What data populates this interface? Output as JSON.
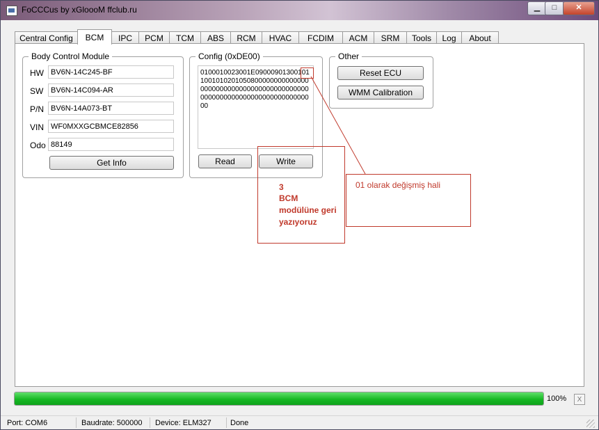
{
  "window": {
    "title": "FoCCCus by xGloooM ffclub.ru",
    "min": "▁",
    "max": "□",
    "close": "✕"
  },
  "tabs": [
    "Central Config",
    "BCM",
    "IPC",
    "PCM",
    "TCM",
    "ABS",
    "RCM",
    "HVAC",
    "FCDIM",
    "ACM",
    "SRM",
    "Tools",
    "Log",
    "About"
  ],
  "active_tab": "BCM",
  "bcm": {
    "title": "Body Control Module",
    "hw_label": "HW",
    "hw_value": "BV6N-14C245-BF",
    "sw_label": "SW",
    "sw_value": "BV6N-14C094-AR",
    "pn_label": "P/N",
    "pn_value": "BV6N-14A073-BT",
    "vin_label": "VIN",
    "vin_value": "WF0MXXGCBMCE82856",
    "odo_label": "Odo",
    "odo_value": "88149",
    "get_info": "Get Info"
  },
  "config": {
    "title": "Config (0xDE00)",
    "text": "0100010023001E0900090130010110010102010508000000000000000000000000000000000000000000000000000000000000000000000000",
    "read": "Read",
    "write": "Write"
  },
  "other": {
    "title": "Other",
    "reset": "Reset ECU",
    "wmm": "WMM Calibration"
  },
  "annotations": {
    "note_changed": "01 olarak değişmiş hali",
    "step_num": "3",
    "step_l1": "BCM",
    "step_l2": "modülüne geri",
    "step_l3": "yazıyoruz",
    "accent": "#c0392b"
  },
  "progress": {
    "value": 100,
    "label": "100%",
    "cancel": "X"
  },
  "status": {
    "port": "Port: COM6",
    "baud": "Baudrate: 500000",
    "device": "Device: ELM327",
    "state": "Done"
  }
}
